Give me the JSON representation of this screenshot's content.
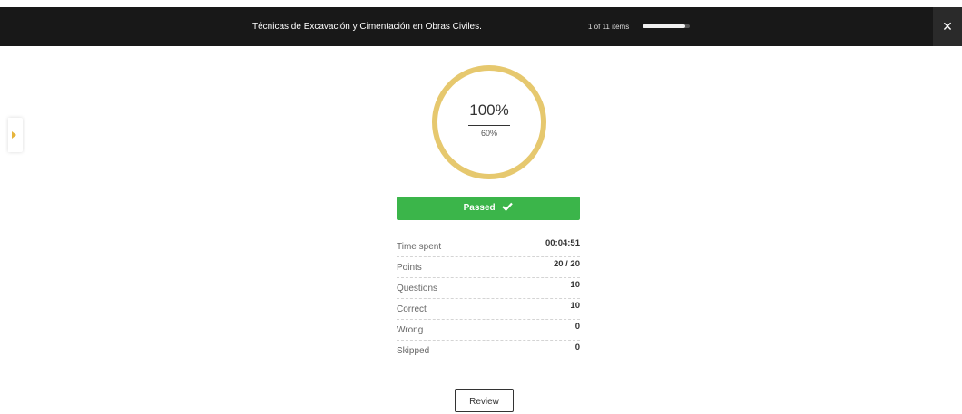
{
  "header": {
    "course_title": "Técnicas de Excavación y Cimentación en Obras Civiles.",
    "items_count": "1 of 11 items",
    "progress_fraction": 0.91,
    "close_icon": "close-icon"
  },
  "sidebar_toggle": {
    "icon": "chevron-right-icon",
    "accent": "#e6b43c"
  },
  "result": {
    "score": "100%",
    "passing_grade": "60%",
    "ring_color": "#e6c86e",
    "status_label": "Passed",
    "status_color": "#3bb54a"
  },
  "stats": [
    {
      "label": "Time spent",
      "value": "00:04:51"
    },
    {
      "label": "Points",
      "value": "20 / 20"
    },
    {
      "label": "Questions",
      "value": "10"
    },
    {
      "label": "Correct",
      "value": "10"
    },
    {
      "label": "Wrong",
      "value": "0"
    },
    {
      "label": "Skipped",
      "value": "0"
    }
  ],
  "actions": {
    "review_label": "Review"
  }
}
